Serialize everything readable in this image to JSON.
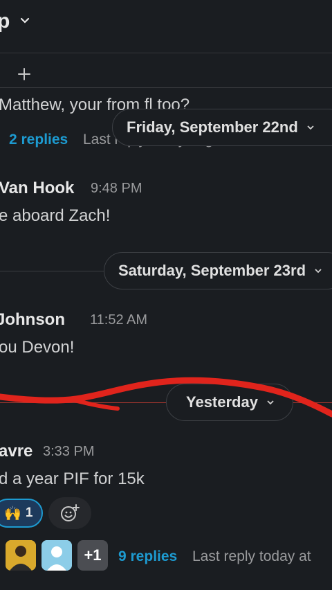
{
  "header": {
    "title": "p"
  },
  "thread1": {
    "text": "Matthew, your from fl too?",
    "replies": "2 replies",
    "last_reply": "Last reply 5 days ago"
  },
  "dividers": {
    "friday": "Friday, September 22nd",
    "saturday": "Saturday, September 23rd",
    "yesterday": "Yesterday"
  },
  "msg1": {
    "sender": "Van Hook",
    "time": "9:48 PM",
    "text": "e aboard Zach!"
  },
  "msg2": {
    "sender": "Johnson",
    "time": "11:52 AM",
    "text": "ou Devon!"
  },
  "msg3": {
    "sender": "avre",
    "time": "3:33 PM",
    "text": "d a year PIF for 15k"
  },
  "reaction": {
    "emoji": "🙌",
    "count": "1"
  },
  "thread2": {
    "more_avatars": "+1",
    "replies": "9 replies",
    "last_reply": "Last reply today at"
  },
  "colors": {
    "background": "#1a1d21",
    "link": "#1d9bd1",
    "annotation": "#e0241c"
  }
}
